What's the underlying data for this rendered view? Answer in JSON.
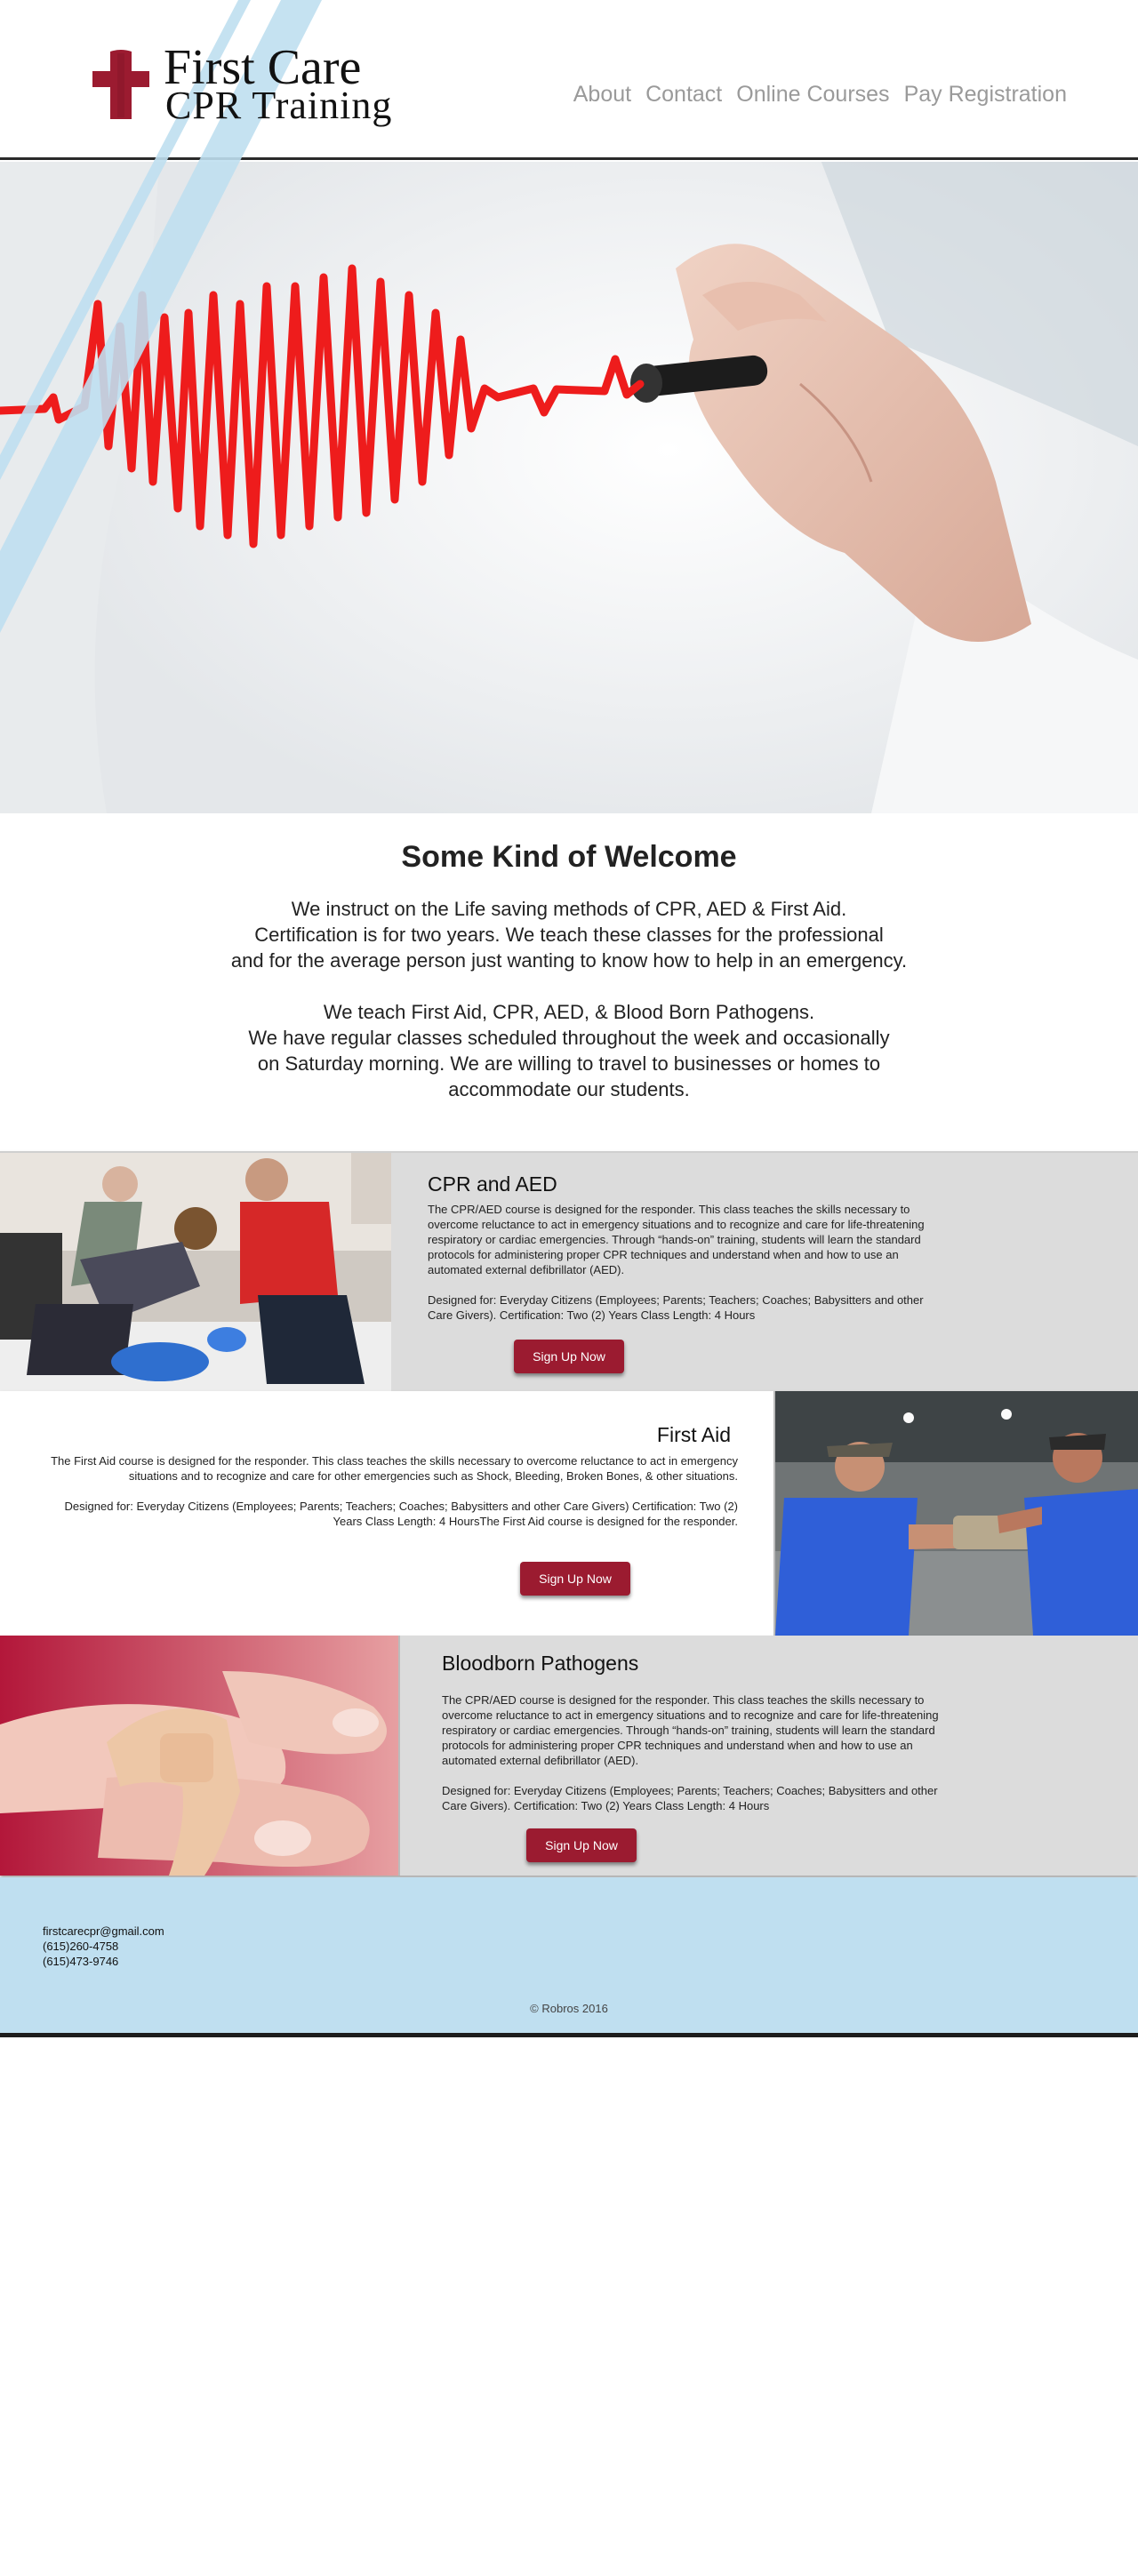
{
  "brand": {
    "line1": "First Care",
    "line2": "CPR Training",
    "accent": "#9b1b30"
  },
  "nav": [
    {
      "label": "About"
    },
    {
      "label": "Contact"
    },
    {
      "label": "Online Courses"
    },
    {
      "label": "Pay Registration"
    }
  ],
  "welcome": {
    "title": "Some Kind of Welcome",
    "paragraph1": [
      "We instruct on the Life saving methods of CPR, AED & First Aid.",
      "Certification is for two years. We teach these classes for the professional",
      "and for the average person just wanting to know how to help in an emergency."
    ],
    "paragraph2": [
      "We teach First Aid, CPR, AED, & Blood Born Pathogens.",
      "We have regular classes scheduled throughout the week and occasionally",
      "on Saturday morning. We are willing to travel to businesses or homes to",
      "accommodate our students."
    ]
  },
  "courses": [
    {
      "title": "CPR and AED",
      "description": "The CPR/AED course is designed for the responder. This class teaches the skills necessary to overcome reluctance to act in emergency situations and to recognize and care for life-threatening respiratory or cardiac emergencies. Through “hands-on” training, students will learn the standard protocols for administering proper CPR techniques and understand when and how to use an automated external defibrillator (AED).",
      "details": "Designed for: Everyday Citizens (Employees; Parents; Teachers; Coaches; Babysitters and other Care Givers). Certification: Two (2) Years Class Length: 4 Hours",
      "button": "Sign Up Now"
    },
    {
      "title": "First Aid",
      "description": "The First Aid course is designed for the responder. This class teaches the skills necessary to overcome reluctance to act in emergency situations and to recognize and care for other emergencies such as Shock, Bleeding, Broken Bones, & other situations.",
      "details": "Designed for: Everyday Citizens (Employees; Parents; Teachers; Coaches; Babysitters and other Care Givers) Certification: Two (2) Years Class Length: 4 HoursThe First Aid course is designed for the responder.",
      "button": "Sign Up Now"
    },
    {
      "title": "Bloodborn Pathogens",
      "description": "The CPR/AED course is designed for the responder. This class teaches the skills necessary to overcome reluctance to act in emergency situations and to recognize and care for life-threatening respiratory or cardiac emergencies. Through “hands-on” training, students will learn the standard protocols for administering proper CPR techniques and understand when and how to use an automated external defibrillator (AED).",
      "details": "Designed for: Everyday Citizens (Employees; Parents; Teachers; Coaches; Babysitters and other Care Givers). Certification: Two (2) Years Class Length: 4 Hours",
      "button": "Sign Up Now"
    }
  ],
  "footer": {
    "email": "firstcarecpr@gmail.com",
    "phone1": "(615)260-4758",
    "phone2": "(615)473-9746",
    "copyright": "© Robros 2016"
  }
}
